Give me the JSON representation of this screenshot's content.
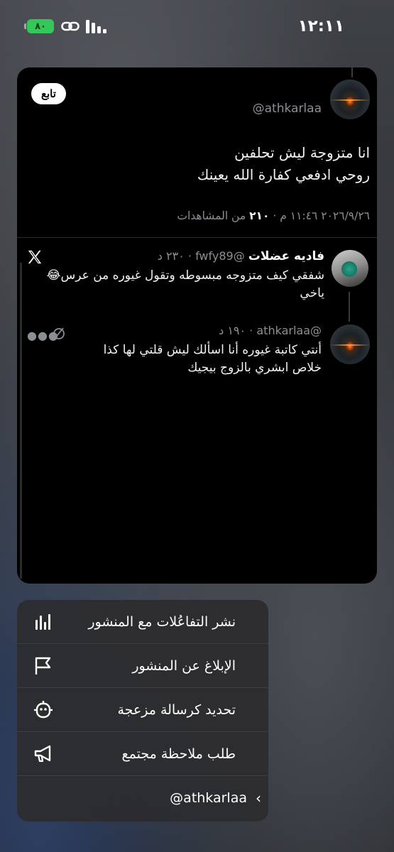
{
  "status_bar": {
    "time": "١٢:١١",
    "battery": "٨٠",
    "icons": [
      "charging-battery-icon",
      "link-icon",
      "signal-icon"
    ]
  },
  "tweet": {
    "follow_label": "تابع",
    "handle": "@athkarlaa",
    "text_line1": "انا متزوجة ليش تحلفين",
    "text_line2": "روحي ادفعي كفارة الله يعينك",
    "meta_prefix": "٢٠٢٦/٩/٢٦ ١١:٤٦ م · ",
    "views_count": "٢١٠",
    "views_label": " من المشاهدات"
  },
  "replies": [
    {
      "name": "فاديه عضلات",
      "handle": "@fwfy89 · ٢٣٠ د",
      "text": "شفقي كيف متزوجه مبسوطه وتقول غيوره من عرس😂 ياخي"
    },
    {
      "handle": "@athkarlaa · ١٩٠ د",
      "text_line1": "أنتي كاتبة غيوره أنا اسألك ليش قلتي لها كذا",
      "text_line2": "خلاص ابشري بالزوج بيجيك"
    }
  ],
  "menu": {
    "items": [
      {
        "label": "نشر التفاعُلات مع المنشور",
        "icon": "bar-chart-icon"
      },
      {
        "label": "الإبلاغ عن المنشور",
        "icon": "flag-icon"
      },
      {
        "label": "تحديد كرسالة مزعجة",
        "icon": "robot-icon"
      },
      {
        "label": "طلب ملاحظة مجتمع",
        "icon": "megaphone-icon"
      }
    ],
    "footer_label": "@athkarlaa"
  },
  "colors": {
    "card_bg": "#000000",
    "muted_text": "#8b8f94",
    "battery_green": "#34c759",
    "menu_bg": "#2c2c30"
  }
}
